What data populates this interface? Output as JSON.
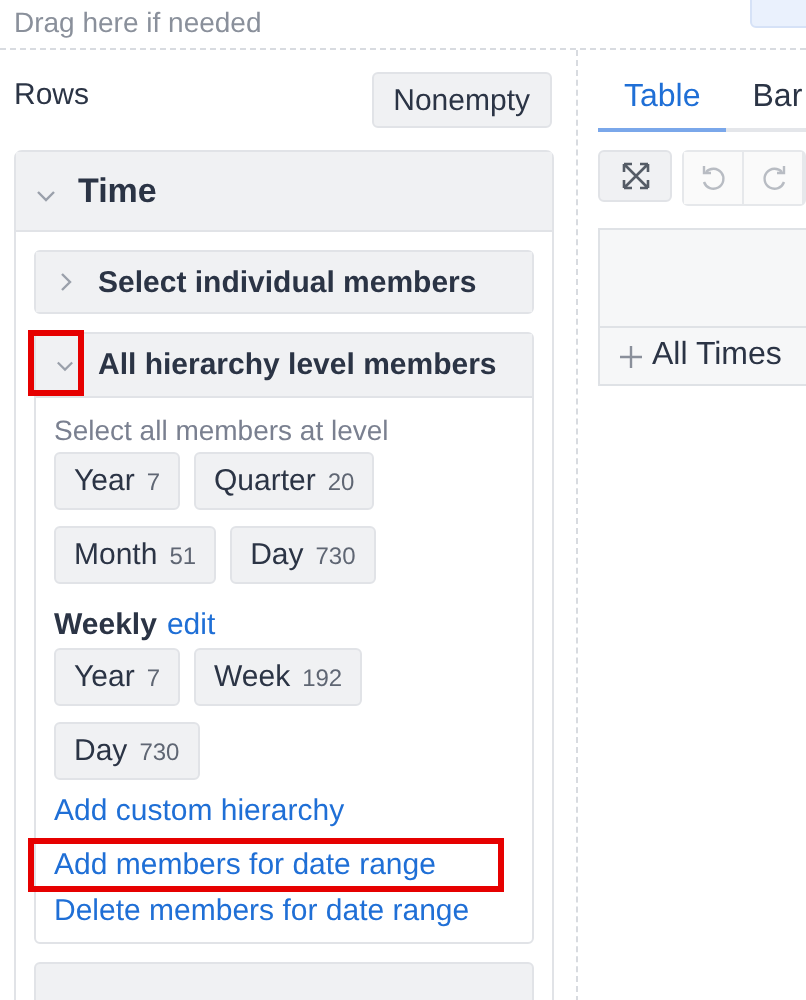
{
  "drop_hint": "Drag here if needed",
  "rows": {
    "title": "Rows",
    "nonempty_button": "Nonempty"
  },
  "dimension": {
    "name": "Time",
    "expanded": true,
    "sections": [
      {
        "title": "Select individual members",
        "expanded": false,
        "highlighted": false
      },
      {
        "title": "All hierarchy level members",
        "expanded": true,
        "highlighted": true,
        "level_caption": "Select all members at level",
        "levels": [
          {
            "name": "Year",
            "count": "7"
          },
          {
            "name": "Quarter",
            "count": "20"
          },
          {
            "name": "Month",
            "count": "51"
          },
          {
            "name": "Day",
            "count": "730"
          }
        ],
        "hierarchies": [
          {
            "name": "Weekly",
            "edit_link": "edit",
            "levels": [
              {
                "name": "Year",
                "count": "7"
              },
              {
                "name": "Week",
                "count": "192"
              },
              {
                "name": "Day",
                "count": "730"
              }
            ]
          }
        ],
        "links": [
          {
            "label": "Add custom hierarchy",
            "highlighted": false
          },
          {
            "label": "Add members for date range",
            "highlighted": true
          },
          {
            "label": "Delete members for date range",
            "highlighted": false
          }
        ]
      }
    ]
  },
  "view_tabs": [
    {
      "label": "Table",
      "selected": true
    },
    {
      "label": "Bar",
      "selected": false
    }
  ],
  "table": {
    "row_header": "All Times"
  }
}
